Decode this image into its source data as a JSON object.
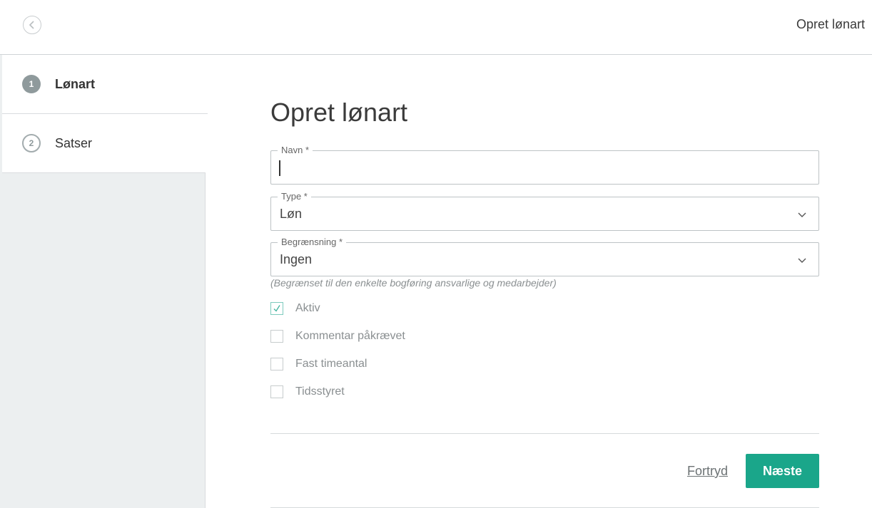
{
  "header": {
    "title": "Opret lønart"
  },
  "steps": [
    {
      "number": "1",
      "label": "Lønart"
    },
    {
      "number": "2",
      "label": "Satser"
    }
  ],
  "form": {
    "title": "Opret lønart",
    "name_field": {
      "label": "Navn *",
      "value": ""
    },
    "type_field": {
      "label": "Type *",
      "value": "Løn"
    },
    "restriction_field": {
      "label": "Begrænsning *",
      "value": "Ingen"
    },
    "restriction_hint": "(Begrænset til den enkelte bogføring ansvarlige og medarbejder)",
    "checkboxes": [
      {
        "label": "Aktiv",
        "checked": true
      },
      {
        "label": "Kommentar påkrævet",
        "checked": false
      },
      {
        "label": "Fast timeantal",
        "checked": false
      },
      {
        "label": "Tidsstyret",
        "checked": false
      }
    ],
    "cancel_label": "Fortryd",
    "next_label": "Næste"
  },
  "colors": {
    "accent": "#1aa68a",
    "check_mark": "#3fb39d",
    "sidebar_bg": "#eceff0"
  }
}
